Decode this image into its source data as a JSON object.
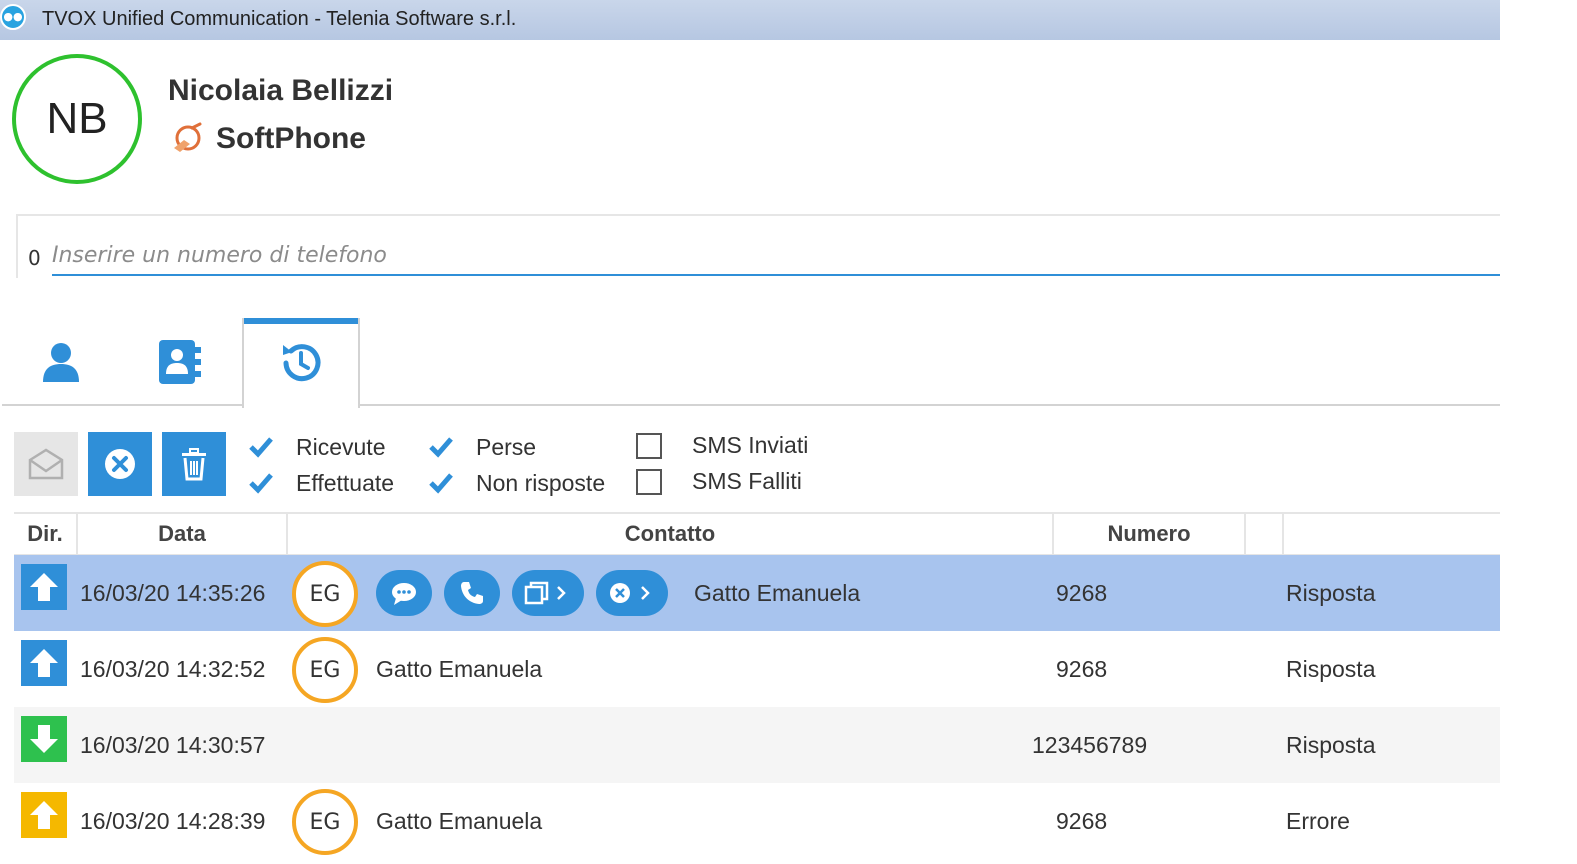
{
  "window": {
    "title": "TVOX Unified Communication - Telenia Software s.r.l."
  },
  "user": {
    "initials": "NB",
    "name": "Nicolaia Bellizzi",
    "device": "SoftPhone",
    "presence_color": "#2ec12e"
  },
  "dial": {
    "counter": "0",
    "placeholder": "Inserire un numero di telefono"
  },
  "tabs": [
    {
      "icon": "person-icon",
      "active": false
    },
    {
      "icon": "address-book-icon",
      "active": false
    },
    {
      "icon": "history-icon",
      "active": true
    }
  ],
  "toolbar": {
    "buttons": [
      "envelope-icon",
      "clear-icon",
      "trash-icon"
    ]
  },
  "filters": [
    {
      "label": "Ricevute",
      "checked": true
    },
    {
      "label": "Effettuate",
      "checked": true
    },
    {
      "label": "Perse",
      "checked": true
    },
    {
      "label": "Non risposte",
      "checked": true
    },
    {
      "label": "SMS Inviati",
      "checked": false
    },
    {
      "label": "SMS Falliti",
      "checked": false
    }
  ],
  "table": {
    "headers": {
      "dir": "Dir.",
      "date": "Data",
      "contact": "Contatto",
      "number": "Numero",
      "status": ""
    },
    "rows": [
      {
        "direction": "outgoing",
        "dir_color": "#2f8fd8",
        "date": "16/03/20 14:35:26",
        "initials": "EG",
        "contact": "Gatto Emanuela",
        "number": "9268",
        "status": "Risposta",
        "selected": true
      },
      {
        "direction": "outgoing",
        "dir_color": "#2f8fd8",
        "date": "16/03/20 14:32:52",
        "initials": "EG",
        "contact": "Gatto Emanuela",
        "number": "9268",
        "status": "Risposta",
        "selected": false
      },
      {
        "direction": "incoming",
        "dir_color": "#2ec14e",
        "date": "16/03/20 14:30:57",
        "initials": "",
        "contact": "",
        "number": "123456789",
        "status": "Risposta",
        "selected": false
      },
      {
        "direction": "outgoing",
        "dir_color": "#f5b800",
        "date": "16/03/20 14:28:39",
        "initials": "EG",
        "contact": "Gatto Emanuela",
        "number": "9268",
        "status": "Errore",
        "selected": false
      }
    ]
  },
  "row_actions": [
    "chat-icon",
    "phone-icon",
    "copy-icon",
    "close-circle-icon"
  ],
  "colors": {
    "accent": "#2f8fd8",
    "selection": "#a8c4ee",
    "contact_avatar": "#f5a623"
  }
}
